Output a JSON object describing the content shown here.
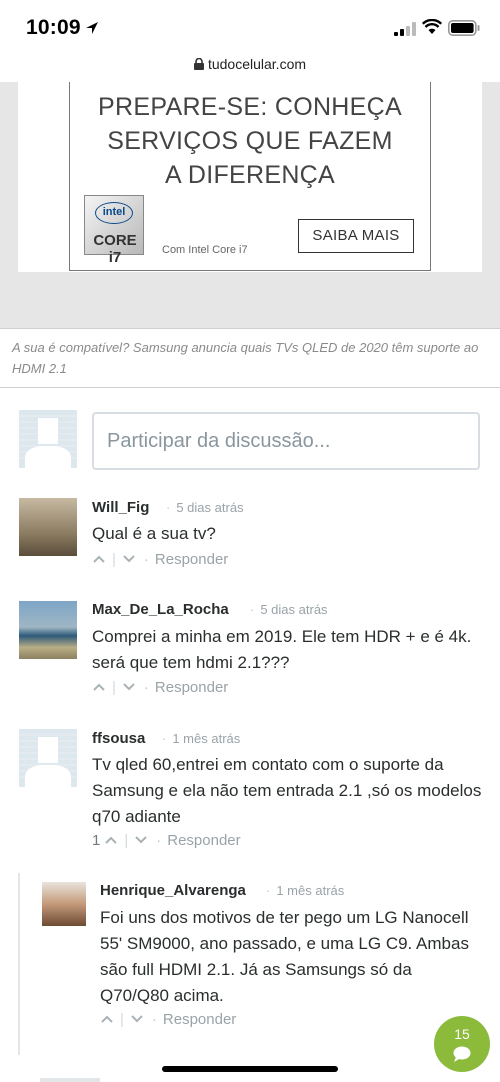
{
  "status_bar": {
    "time": "10:09"
  },
  "browser": {
    "url": "tudocelular.com"
  },
  "ad": {
    "headline_lines": [
      "PREPARE-SE: CONHEÇA",
      "SERVIÇOS QUE FAZEM",
      "A DIFERENÇA"
    ],
    "badge_logo": "intel",
    "badge_model": "CORE i7",
    "caption": "Com Intel Core i7",
    "cta_label": "SAIBA MAIS"
  },
  "article_caption": "A sua é compatível? Samsung anuncia quais TVs QLED de 2020 têm suporte ao HDMI 2.1",
  "discussion": {
    "input_placeholder": "Participar da discussão...",
    "comments": [
      {
        "author": "Will_Fig",
        "time": "5 dias atrás",
        "text": "Qual é a sua tv?",
        "votes": "",
        "reply_label": "Responder"
      },
      {
        "author": "Max_De_La_Rocha",
        "time": "5 dias atrás",
        "text": "Comprei a minha em 2019. Ele tem HDR + e é 4k. será que tem hdmi 2.1???",
        "votes": "",
        "reply_label": "Responder"
      },
      {
        "author": "ffsousa",
        "time": "1 mês atrás",
        "text": "Tv qled 60,entrei em contato com o suporte da Samsung e ela não tem entrada 2.1 ,só os modelos q70 adiante",
        "votes": "1",
        "reply_label": "Responder"
      },
      {
        "author": "Henrique_Alvarenga",
        "time": "1 mês atrás",
        "text": "Foi uns dos motivos de ter pego um LG Nanocell 55' SM9000, ano passado, e uma LG C9. Ambas são full HDMI 2.1. Já as Samsungs só da Q70/Q80 acima.",
        "votes": "",
        "reply_label": "Responder"
      }
    ]
  },
  "fab": {
    "count": "15"
  },
  "colors": {
    "accent_green": "#8cbb3b",
    "muted_text": "#9aa3a8",
    "author_text": "#2a2e2e"
  }
}
